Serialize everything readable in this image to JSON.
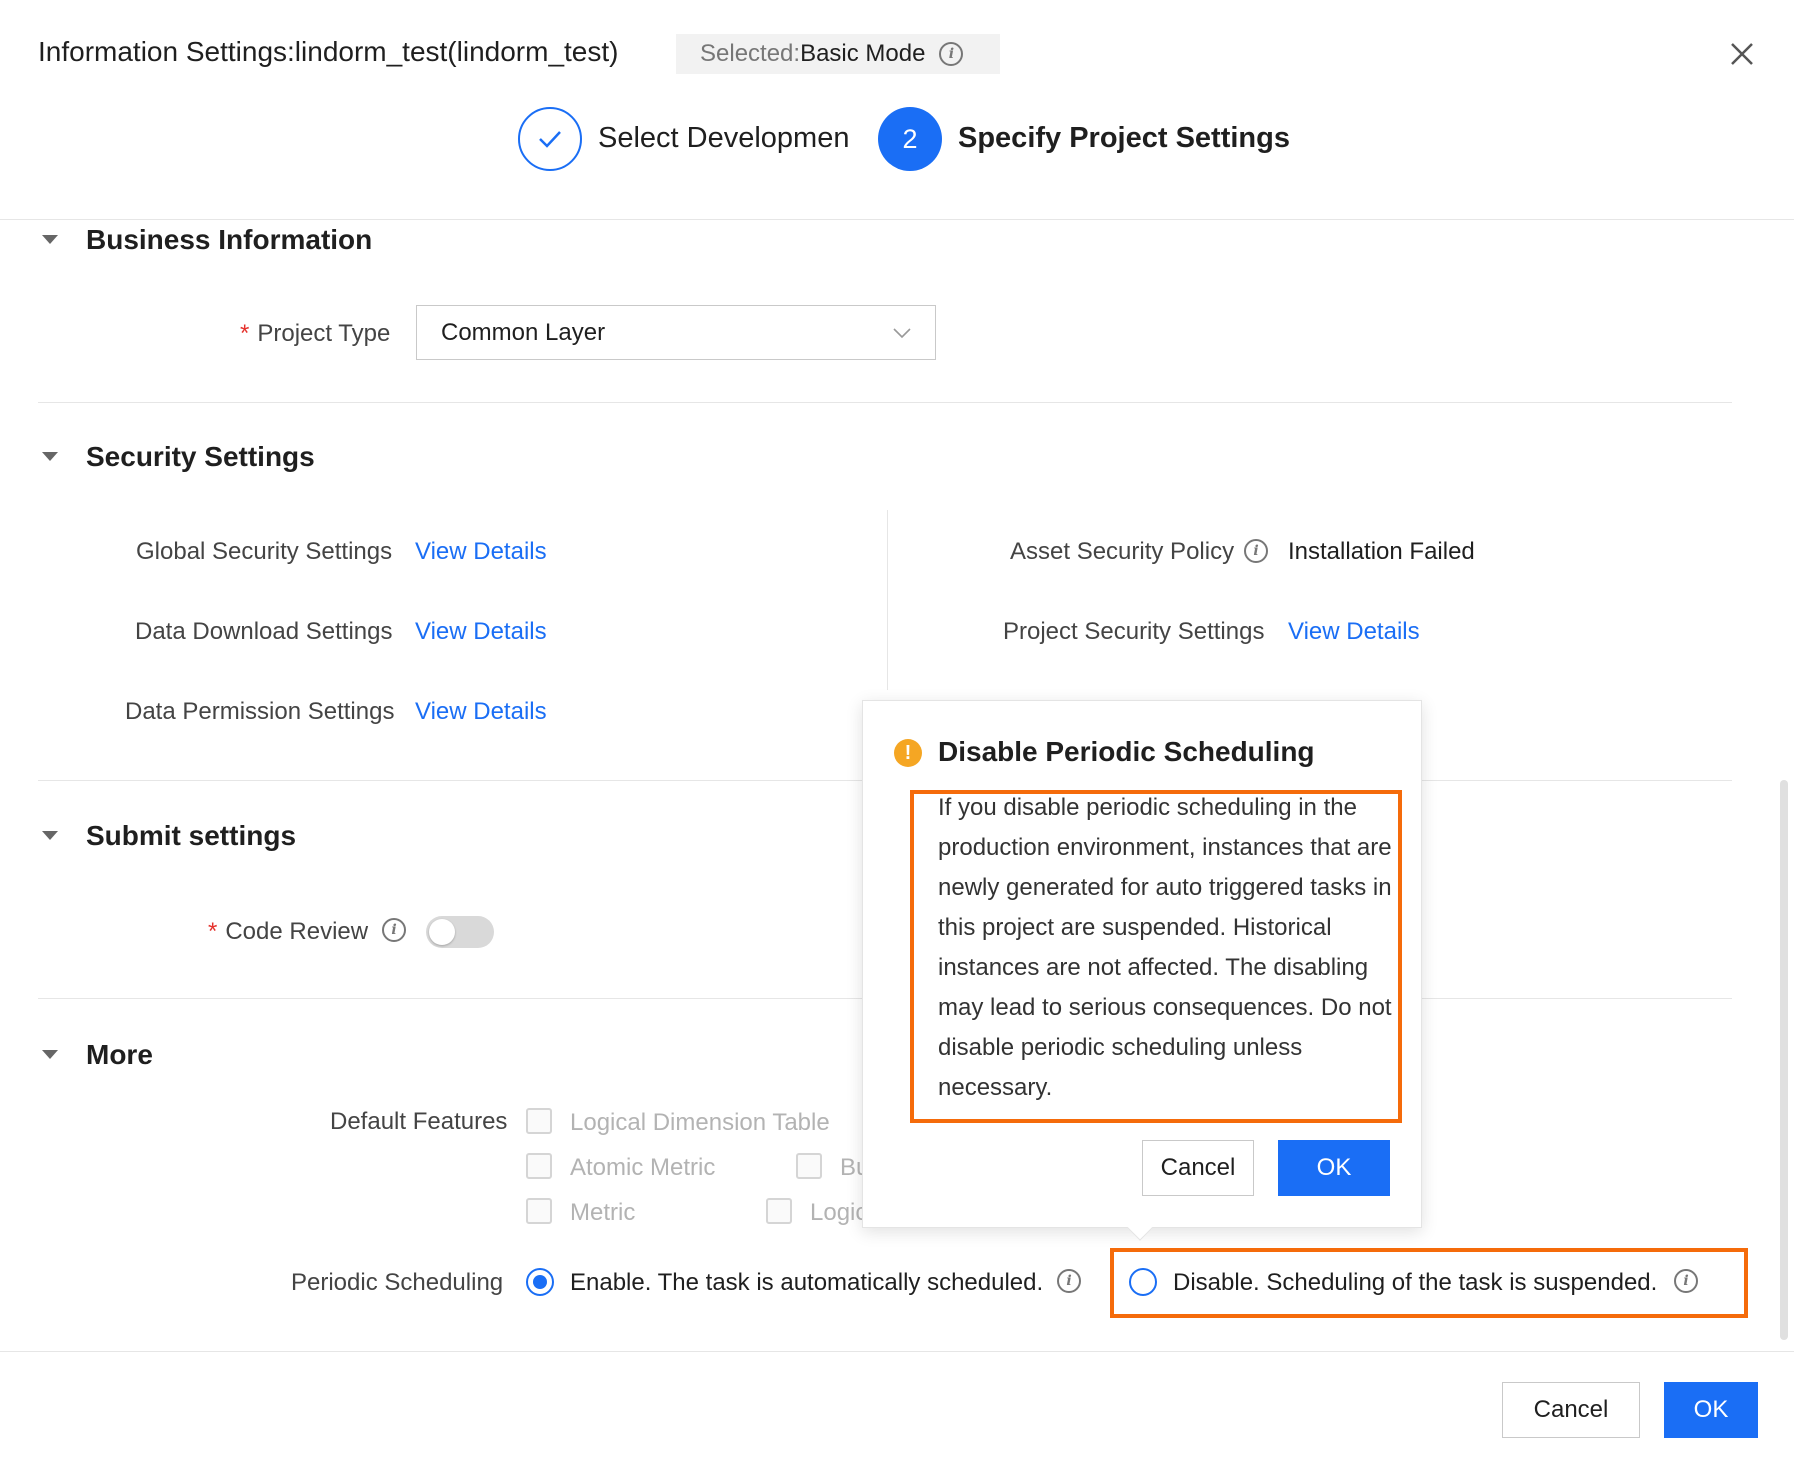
{
  "header": {
    "title": "Information Settings:lindorm_test(lindorm_test)",
    "mode_label": "Selected:",
    "mode_value": "Basic Mode"
  },
  "steps": [
    {
      "label": "Select Development Mode",
      "status": "done"
    },
    {
      "number": "2",
      "label": "Specify Project Settings",
      "status": "active"
    }
  ],
  "business": {
    "title": "Business Information",
    "project_type_label": "Project Type",
    "project_type_value": "Common Layer"
  },
  "security": {
    "title": "Security Settings",
    "global_label": "Global Security Settings",
    "download_label": "Data Download Settings",
    "permission_label": "Data Permission Settings",
    "asset_label": "Asset Security Policy",
    "asset_value": "Installation Failed",
    "project_label": "Project Security Settings",
    "view_details": "View Details"
  },
  "submit": {
    "title": "Submit settings",
    "code_review_label": "Code Review"
  },
  "more": {
    "title": "More",
    "default_features_label": "Default Features",
    "features": [
      "Logical Dimension Table",
      "Atomic Metric",
      "Bu",
      "Metric",
      "Logic"
    ],
    "periodic_label": "Periodic Scheduling",
    "enable_label": "Enable. The task is automatically scheduled.",
    "disable_label": "Disable. Scheduling of the task is suspended."
  },
  "popover": {
    "title": "Disable Periodic Scheduling",
    "body": "If you disable periodic scheduling in the production environment, instances that are newly generated for auto triggered tasks in this project are suspended. Historical instances are not affected. The disabling may lead to serious consequences. Do not disable periodic scheduling unless necessary.",
    "cancel": "Cancel",
    "ok": "OK"
  },
  "footer": {
    "cancel": "Cancel",
    "ok": "OK"
  },
  "colors": {
    "primary": "#1a6ef5",
    "highlight": "#f56b0a",
    "warning": "#f5a623",
    "required": "#e5322d"
  }
}
